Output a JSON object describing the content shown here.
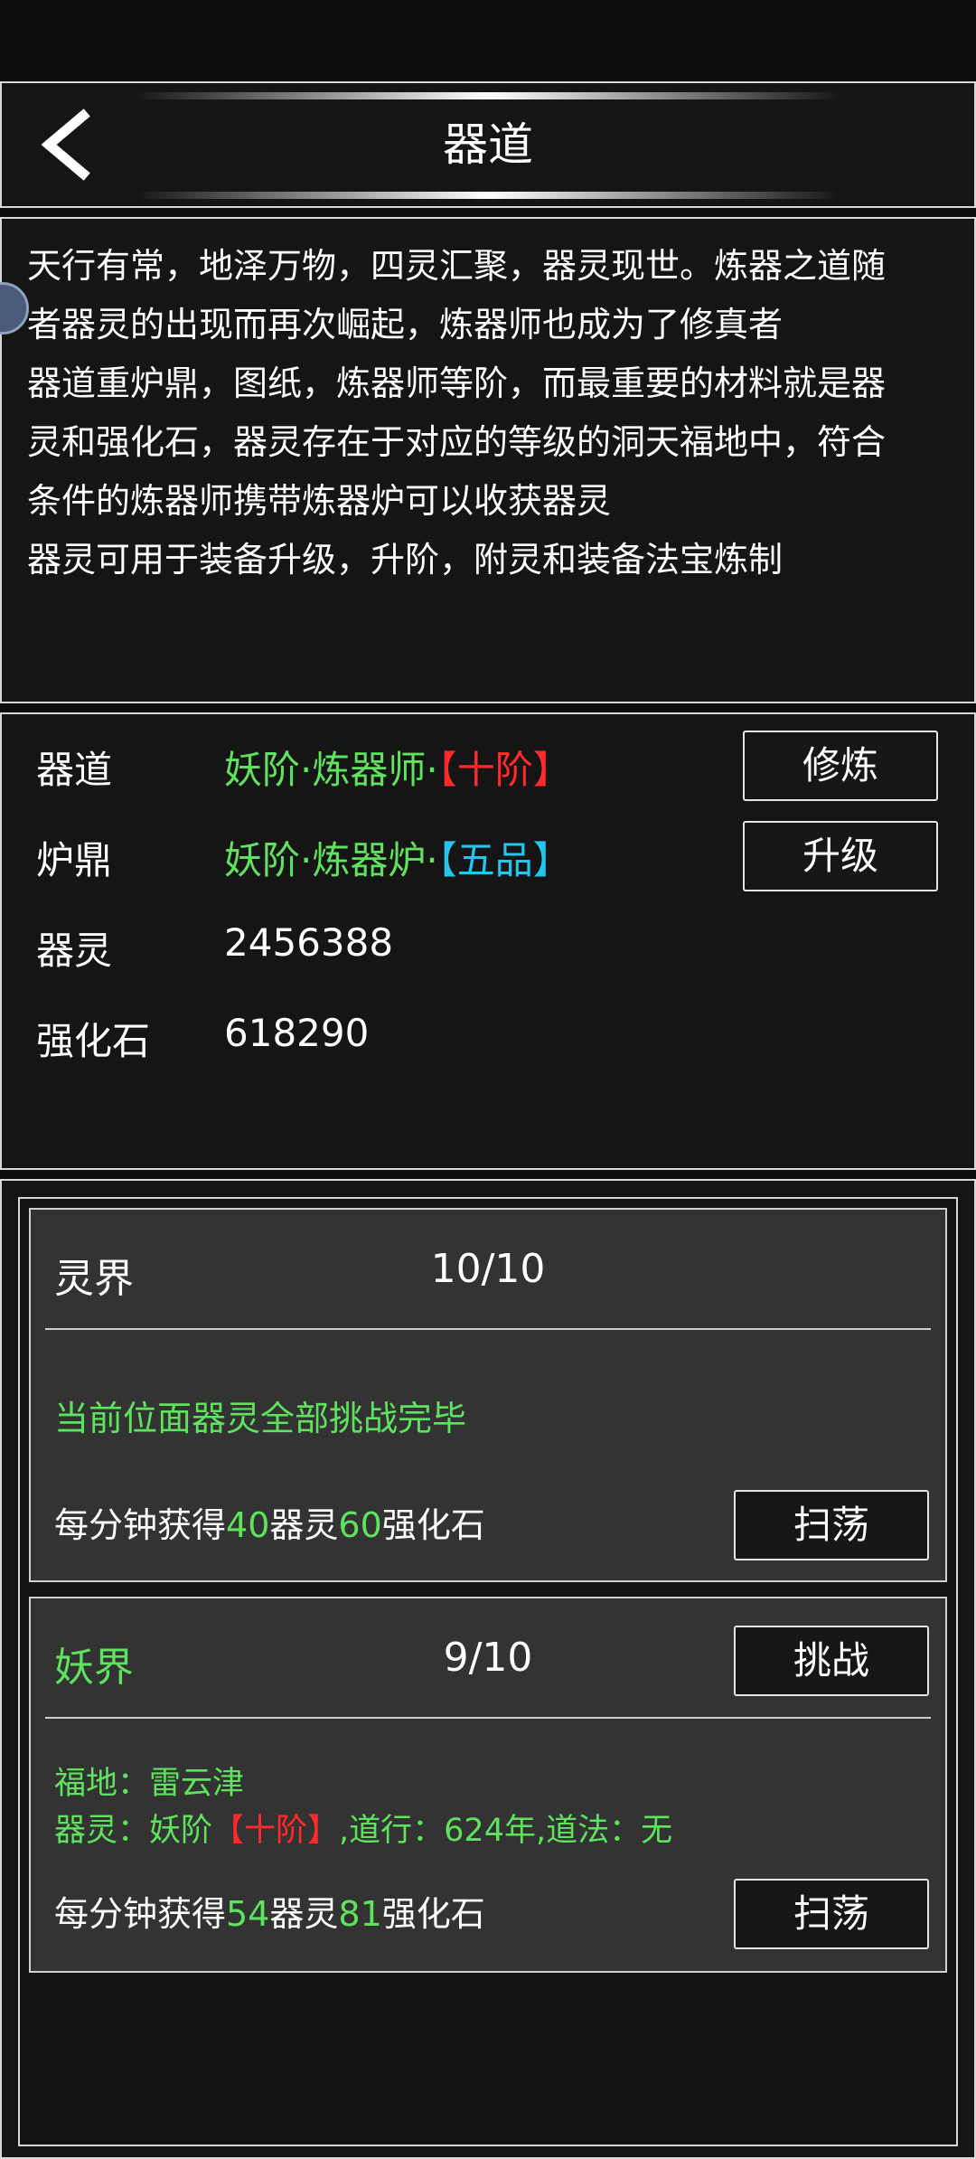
{
  "header": {
    "title": "器道"
  },
  "description": {
    "lines": [
      "天行有常，地泽万物，四灵汇聚，器灵现世。炼器之道随",
      "者器灵的出现而再次崛起，炼器师也成为了修真者",
      "器道重炉鼎，图纸，炼器师等阶，而最重要的材料就是器",
      "灵和强化石，器灵存在于对应的等级的洞天福地中，符合",
      "条件的炼器师携带炼器炉可以收获器灵",
      "器灵可用于装备升级，升阶，附灵和装备法宝炼制"
    ]
  },
  "stats": {
    "qidao": {
      "label": "器道",
      "value_main": "妖阶·炼器师·",
      "value_rank": "【十阶】",
      "button": "修炼"
    },
    "luding": {
      "label": "炉鼎",
      "value_main": "妖阶·炼器炉·",
      "value_rank": "【五品】",
      "button": "升级"
    },
    "qiling": {
      "label": "器灵",
      "value": "2456388"
    },
    "qianghuashi": {
      "label": "强化石",
      "value": "618290"
    }
  },
  "realms": [
    {
      "name": "灵界",
      "count": "10/10",
      "status": "当前位面器灵全部挑战完毕",
      "rate_prefix": "每分钟获得",
      "rate_qiling": "40",
      "rate_mid": "器灵",
      "rate_stone": "60",
      "rate_suffix": "强化石",
      "sweep_button": "扫荡"
    },
    {
      "name": "妖界",
      "count": "9/10",
      "challenge_button": "挑战",
      "fudi_label": "福地：",
      "fudi_value": "雷云津",
      "spirit_prefix": "器灵：妖阶",
      "spirit_rank": "【十阶】",
      "spirit_suffix": ",道行：624年,道法：无",
      "rate_prefix": "每分钟获得",
      "rate_qiling": "54",
      "rate_mid": "器灵",
      "rate_stone": "81",
      "rate_suffix": "强化石",
      "sweep_button": "扫荡"
    }
  ],
  "colors": {
    "green": "#5fe35f",
    "red": "#ff2a2a",
    "cyan": "#23c6ee",
    "card_bg": "#333333",
    "page_bg": "#0d0d0d"
  }
}
